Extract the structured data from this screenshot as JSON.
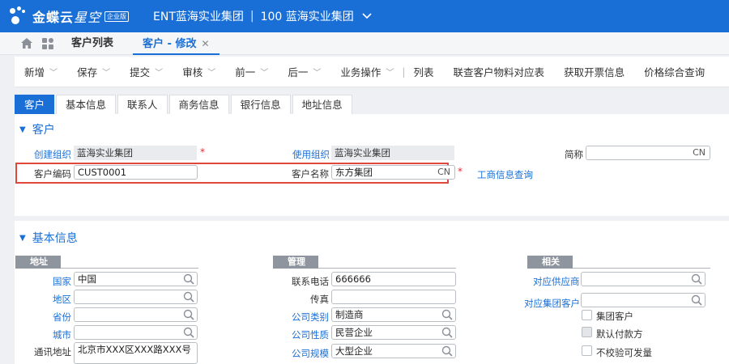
{
  "header": {
    "brand": "金蝶云",
    "brand_light": "星空",
    "edition": "企业版",
    "org_left": "ENT蓝海实业集团",
    "org_right": "100 蓝海实业集团"
  },
  "doc_tabs": [
    {
      "label": "客户列表",
      "closable": false,
      "active": false
    },
    {
      "label": "客户 - 修改",
      "closable": true,
      "active": true
    }
  ],
  "toolbar": [
    {
      "label": "新增",
      "caret": true
    },
    {
      "label": "保存",
      "caret": true
    },
    {
      "label": "提交",
      "caret": true
    },
    {
      "label": "审核",
      "caret": true
    },
    {
      "label": "前一",
      "caret": true
    },
    {
      "label": "后一",
      "caret": true
    },
    {
      "label": "业务操作",
      "caret": true
    },
    {
      "label": "列表",
      "caret": false
    },
    {
      "label": "联查客户物料对应表",
      "caret": false
    },
    {
      "label": "获取开票信息",
      "caret": false
    },
    {
      "label": "价格综合查询",
      "caret": false
    }
  ],
  "form_tabs": [
    "客户",
    "基本信息",
    "联系人",
    "商务信息",
    "银行信息",
    "地址信息"
  ],
  "customer_section": {
    "title": "客户",
    "create_org_label": "创建组织",
    "create_org_value": "蓝海实业集团",
    "use_org_label": "使用组织",
    "use_org_value": "蓝海实业集团",
    "short_name_label": "简称",
    "short_name_value": "",
    "code_label": "客户编码",
    "code_value": "CUST0001",
    "name_label": "客户名称",
    "name_value": "东方集团",
    "lang_tag": "CN",
    "required_mark": "*",
    "biz_query_link": "工商信息查询"
  },
  "basic_section": {
    "title": "基本信息",
    "address_group": "地址",
    "manage_group": "管理",
    "related_group": "相关",
    "country_label": "国家",
    "country_value": "中国",
    "region_label": "地区",
    "region_value": "",
    "province_label": "省份",
    "province_value": "",
    "city_label": "城市",
    "city_value": "",
    "address_label": "通讯地址",
    "address_value": "北京市XXX区XXX路XXX号",
    "phone_label": "联系电话",
    "phone_value": "666666",
    "fax_label": "传真",
    "fax_value": "",
    "company_type_label": "公司类别",
    "company_type_value": "制造商",
    "company_nature_label": "公司性质",
    "company_nature_value": "民营企业",
    "company_scale_label": "公司规模",
    "company_scale_value": "大型企业",
    "supplier_label": "对应供应商",
    "supplier_value": "",
    "group_customer_label": "对应集团客户",
    "group_customer_value": "",
    "chk_group_customer": "集团客户",
    "chk_default_payer": "默认付款方",
    "chk_no_verify": "不校验可发量"
  },
  "colors": {
    "primary": "#1a6fd6",
    "highlight_border": "#e0483e",
    "group_header": "#8f959e"
  }
}
